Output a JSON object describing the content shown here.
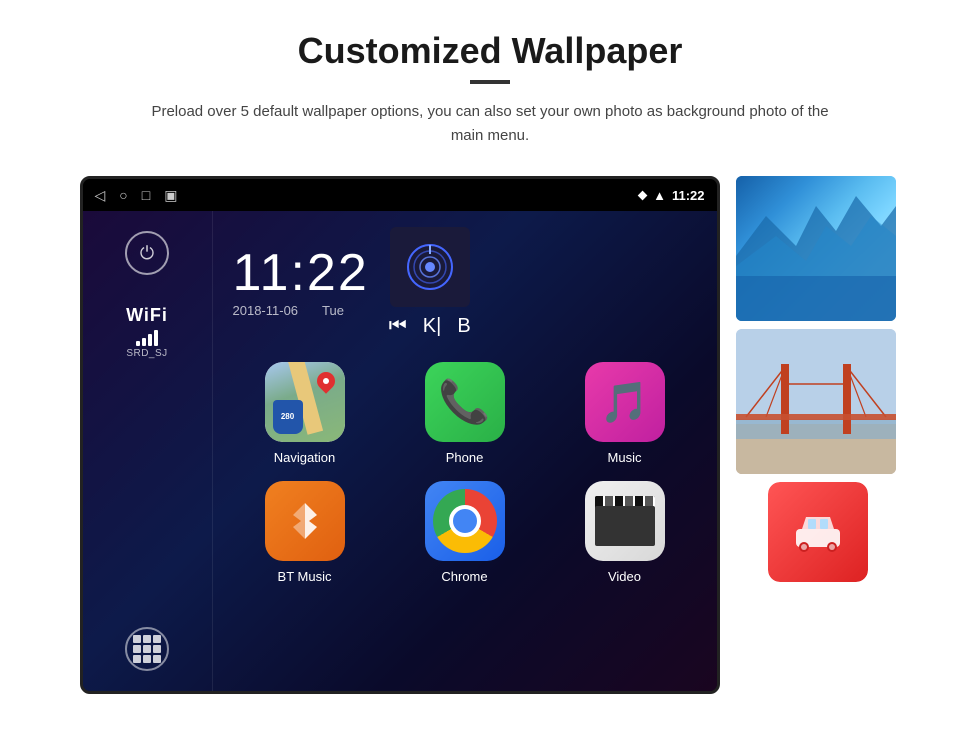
{
  "page": {
    "title": "Customized Wallpaper",
    "divider": true,
    "subtitle": "Preload over 5 default wallpaper options, you can also set your own photo as background photo of the main menu."
  },
  "device": {
    "statusBar": {
      "time": "11:22",
      "navIcons": [
        "◁",
        "○",
        "□",
        "▣"
      ],
      "rightIcons": [
        "location",
        "wifi",
        "signal"
      ]
    },
    "clock": {
      "time": "11:22",
      "date": "2018-11-06",
      "day": "Tue"
    },
    "sidebar": {
      "powerLabel": "⏻",
      "wifiLabel": "WiFi",
      "wifiSSID": "SRD_SJ",
      "appsLabel": "⊞"
    },
    "apps": [
      {
        "id": "navigation",
        "label": "Navigation",
        "type": "navigation"
      },
      {
        "id": "phone",
        "label": "Phone",
        "type": "phone"
      },
      {
        "id": "music",
        "label": "Music",
        "type": "music"
      },
      {
        "id": "bt-music",
        "label": "BT Music",
        "type": "bt-music"
      },
      {
        "id": "chrome",
        "label": "Chrome",
        "type": "chrome"
      },
      {
        "id": "video",
        "label": "Video",
        "type": "video"
      }
    ],
    "navigationBadge": "280"
  },
  "wallpapers": [
    {
      "id": "wp-ice",
      "type": "ice",
      "label": "Ice wallpaper"
    },
    {
      "id": "wp-bridge",
      "type": "bridge",
      "label": "Bridge wallpaper"
    }
  ],
  "carSetting": {
    "label": "CarSetting"
  }
}
